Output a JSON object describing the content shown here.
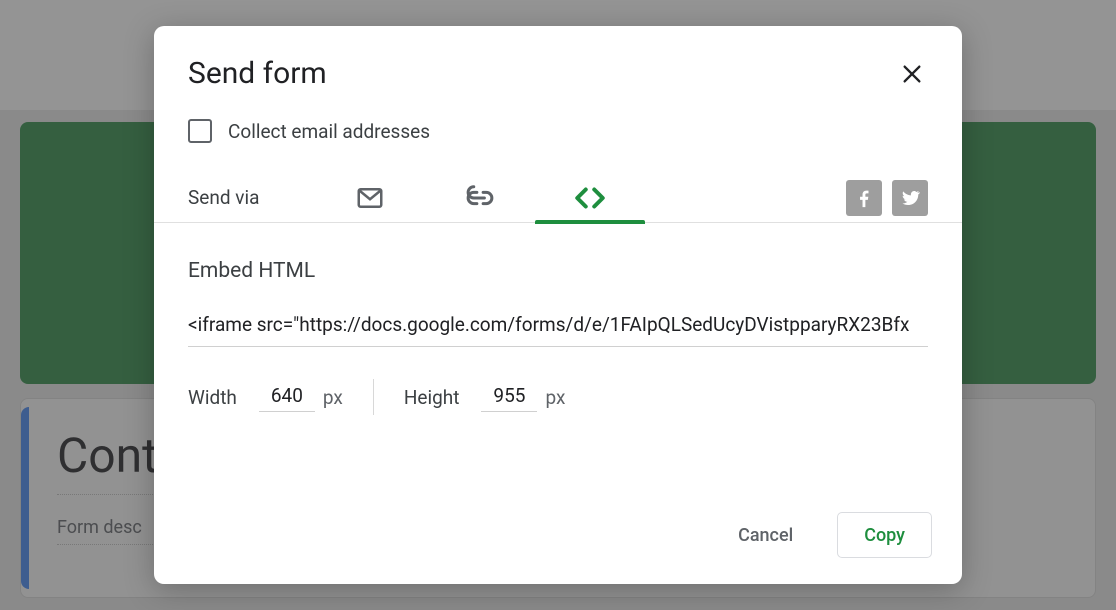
{
  "background": {
    "card_title": "Cont",
    "card_description": "Form desc"
  },
  "modal": {
    "title": "Send form",
    "collect_label": "Collect email addresses",
    "send_via_label": "Send via",
    "tabs": {
      "email": {
        "name": "email-icon"
      },
      "link": {
        "name": "link-icon"
      },
      "embed": {
        "name": "embed-icon",
        "active": true
      }
    },
    "social": {
      "facebook": "facebook",
      "twitter": "twitter"
    },
    "embed": {
      "section_title": "Embed HTML",
      "iframe_value": "<iframe src=\"https://docs.google.com/forms/d/e/1FAIpQLSedUcyDVistpparyRX23Bfx",
      "width_label": "Width",
      "width_value": "640",
      "height_label": "Height",
      "height_value": "955",
      "unit": "px"
    },
    "footer": {
      "cancel": "Cancel",
      "copy": "Copy"
    }
  },
  "colors": {
    "accent_green": "#1e8e3e",
    "bg_green": "#2e8b46",
    "text_primary": "#202124",
    "text_secondary": "#5f6368"
  }
}
